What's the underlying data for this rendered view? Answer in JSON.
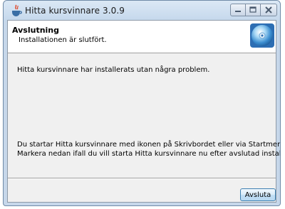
{
  "window": {
    "title": "Hitta kursvinnare 3.0.9",
    "app_icon": "java-cup-icon",
    "controls": [
      "minimize-icon",
      "maximize-icon",
      "close-icon"
    ]
  },
  "header": {
    "title": "Avslutning",
    "subtitle": "Installationen är slutfört.",
    "icon": "cd-disc-icon"
  },
  "body": {
    "message_1": "Hitta kursvinnare har installerats utan några problem.",
    "message_2": "Du startar Hitta kursvinnare med ikonen på Skrivbordet eller via Startmenyn.",
    "message_3": "Markera nedan ifall du vill starta Hitta kursvinnare nu efter avslutad installation:"
  },
  "footer": {
    "finish_label": "Avsluta"
  }
}
